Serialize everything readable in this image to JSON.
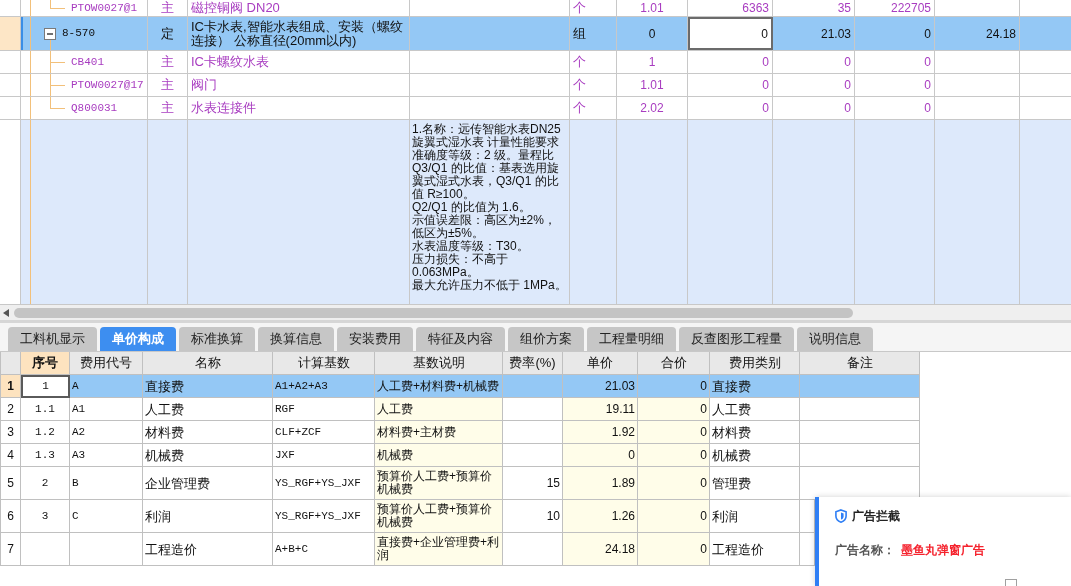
{
  "tree_table": {
    "rows": [
      {
        "kind": "material",
        "selected": false,
        "column_1": "PTOW0027@1",
        "column_2": "主",
        "column_3": "磁控铜阀 DN20",
        "column_5": "个",
        "column_6": "1.01",
        "column_7": "6363",
        "column_8": "35",
        "column_9": "222705"
      },
      {
        "kind": "quota",
        "selected": true,
        "expanded": true,
        "column_7_current": true,
        "column_1": "8-570",
        "column_2": "定",
        "column_3": "IC卡水表,智能水表组成、安装（螺纹连接） 公称直径(20mm以内)",
        "column_5": "组",
        "column_6": "0",
        "column_7": "0",
        "column_8": "21.03",
        "column_9": "0",
        "column_10": "24.18",
        "children": [
          {
            "kind": "material",
            "selected": false,
            "column_1": "CB401",
            "column_2": "主",
            "column_3": "IC卡螺纹水表",
            "column_5": "个",
            "column_6": "1",
            "column_7": "0",
            "column_8": "0",
            "column_9": "0"
          },
          {
            "kind": "material",
            "selected": false,
            "column_1": "PTOW0027@17",
            "column_2": "主",
            "column_3": "阀门",
            "column_5": "个",
            "column_6": "1.01",
            "column_7": "0",
            "column_8": "0",
            "column_9": "0"
          },
          {
            "kind": "material",
            "selected": false,
            "column_1": "Q800031",
            "column_2": "主",
            "column_3": "水表连接件",
            "column_5": "个",
            "column_6": "2.02",
            "column_7": "0",
            "column_8": "0",
            "column_9": "0"
          }
        ]
      },
      {
        "kind": "feature",
        "selected": false,
        "column_4": [
          "1.名称：远传智能水表DN25旋翼式湿水表 计量性能要求",
          "准确度等级：2 级。量程比 Q3/Q1 的比值：基表选用旋翼式湿式水表，Q3/Q1 的比值 R≥100。",
          "Q2/Q1 的比值为 1.6。",
          "示值误差限：高区为±2%，低区为±5%。",
          "水表温度等级：T30。",
          "压力损失：不高于 0.063MPa。",
          "最大允许压力不低于 1MPa。"
        ]
      }
    ]
  },
  "tabs": [
    {
      "label": "工料机显示",
      "selected": false
    },
    {
      "label": "单价构成",
      "selected": true
    },
    {
      "label": "标准换算",
      "selected": false
    },
    {
      "label": "换算信息",
      "selected": false
    },
    {
      "label": "安装费用",
      "selected": false
    },
    {
      "label": "特征及内容",
      "selected": false
    },
    {
      "label": "组价方案",
      "selected": false
    },
    {
      "label": "工程量明细",
      "selected": false
    },
    {
      "label": "反查图形工程量",
      "selected": false
    },
    {
      "label": "说明信息",
      "selected": false
    }
  ],
  "cost_table": {
    "columns": [
      {
        "label": "序号",
        "selected": true
      },
      {
        "label": "费用代号",
        "selected": false
      },
      {
        "label": "名称",
        "selected": false
      },
      {
        "label": "计算基数",
        "selected": false
      },
      {
        "label": "基数说明",
        "selected": false
      },
      {
        "label": "费率(%)",
        "selected": false
      },
      {
        "label": "单价",
        "selected": false
      },
      {
        "label": "合价",
        "selected": false
      },
      {
        "label": "费用类别",
        "selected": false
      },
      {
        "label": "备注",
        "selected": false
      }
    ],
    "rows": [
      {
        "number": "1",
        "selected": true,
        "seq": "1",
        "code": "A",
        "name": "直接费",
        "base": "A1+A2+A3",
        "base_note": "人工费+材料费+机械费",
        "unit_price": "21.03",
        "total": "0",
        "category": "直接费"
      },
      {
        "number": "2",
        "selected": false,
        "seq": "1.1",
        "code": "A1",
        "name": "人工费",
        "base": "RGF",
        "base_note": "人工费",
        "unit_price": "19.11",
        "total": "0",
        "category": "人工费"
      },
      {
        "number": "3",
        "selected": false,
        "seq": "1.2",
        "code": "A2",
        "name": "材料费",
        "base": "CLF+ZCF",
        "base_note": "材料费+主材费",
        "unit_price": "1.92",
        "total": "0",
        "category": "材料费"
      },
      {
        "number": "4",
        "selected": false,
        "seq": "1.3",
        "code": "A3",
        "name": "机械费",
        "base": "JXF",
        "base_note": "机械费",
        "unit_price": "0",
        "total": "0",
        "category": "机械费"
      },
      {
        "number": "5",
        "selected": false,
        "seq": "2",
        "code": "B",
        "name": "企业管理费",
        "base": "YS_RGF+YS_JXF",
        "base_note": "预算价人工费+预算价机械费",
        "rate": "15",
        "unit_price": "1.89",
        "total": "0",
        "category": "管理费"
      },
      {
        "number": "6",
        "selected": false,
        "seq": "3",
        "code": "C",
        "name": "利润",
        "base": "YS_RGF+YS_JXF",
        "base_note": "预算价人工费+预算价机械费",
        "rate": "10",
        "unit_price": "1.26",
        "total": "0",
        "category": "利润"
      },
      {
        "number": "7",
        "selected": false,
        "name": "工程造价",
        "base": "A+B+C",
        "base_note": "直接费+企业管理费+利润",
        "unit_price": "24.18",
        "total": "0",
        "category": "工程造价"
      }
    ]
  },
  "ad_popup": {
    "title": "广告拦截",
    "label": "广告名称：",
    "value": "墨鱼丸弹窗广告",
    "checkbox": {
      "checked": false
    }
  }
}
